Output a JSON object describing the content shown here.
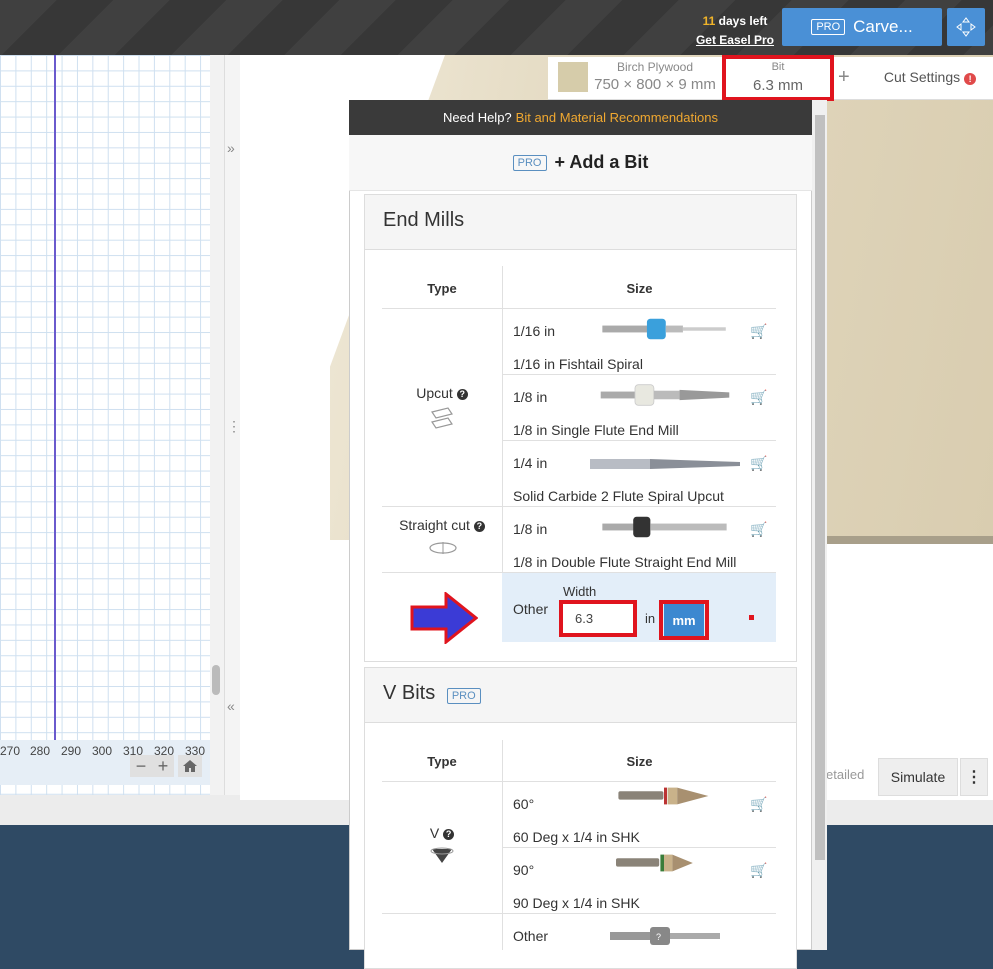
{
  "topbar": {
    "trial_days": "11",
    "trial_suffix": "days left",
    "get_pro_link": "Get Easel Pro",
    "carve_pro_badge": "PRO",
    "carve_label": "Carve...",
    "expand_icon": "expand-arrows-icon"
  },
  "ruler": {
    "ticks": [
      "270",
      "280",
      "290",
      "300",
      "310",
      "320",
      "330"
    ]
  },
  "zoom": {
    "minus": "−",
    "plus": "+",
    "home_icon": "home-icon"
  },
  "divider": {
    "collapse_top": "»",
    "handle": "⋮",
    "collapse_bottom": "«"
  },
  "material": {
    "name": "Birch Plywood",
    "dims": "750 × 800 × 9 mm",
    "bit_label": "Bit",
    "bit_value": "6.3 mm",
    "plus": "+",
    "cut_settings": "Cut Settings",
    "warn": "!"
  },
  "bottom": {
    "detailed": "etailed",
    "simulate": "Simulate",
    "more": "⋮"
  },
  "panel": {
    "help_prefix": "Need Help?",
    "help_link": "Bit and Material Recommendations",
    "add_bit_pro": "PRO",
    "add_bit_label": "+ Add a Bit",
    "end_mills": {
      "title": "End Mills",
      "col_type": "Type",
      "col_size": "Size",
      "upcut_label": "Upcut",
      "straight_label": "Straight cut",
      "rows": [
        {
          "size": "1/16 in",
          "name": "1/16 in Fishtail Spiral"
        },
        {
          "size": "1/8 in",
          "name": "1/8 in Single Flute End Mill"
        },
        {
          "size": "1/4 in",
          "name": "Solid Carbide 2 Flute Spiral Upcut"
        },
        {
          "size": "1/8 in",
          "name": "1/8 in Double Flute Straight End Mill"
        }
      ],
      "other_label": "Other",
      "width_label": "Width",
      "width_value": "6.3",
      "unit_in": "in",
      "unit_mm": "mm"
    },
    "v_bits": {
      "title": "V Bits",
      "pro": "PRO",
      "col_type": "Type",
      "col_size": "Size",
      "v_label": "V",
      "rows": [
        {
          "size": "60°",
          "name": "60 Deg x 1/4 in SHK"
        },
        {
          "size": "90°",
          "name": "90 Deg x 1/4 in SHK"
        }
      ],
      "other_label": "Other"
    }
  },
  "colors": {
    "accent": "#4a90d6",
    "highlight": "#e0141e",
    "arrow": "#3b3bd6",
    "topbar": "#3a3a3a",
    "footer": "#2f4a64"
  }
}
